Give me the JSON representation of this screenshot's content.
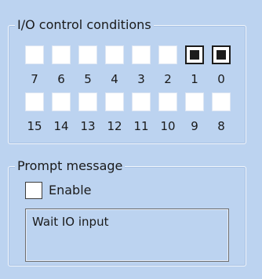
{
  "io_group": {
    "title": "I/O control conditions",
    "row1": [
      {
        "label": "7",
        "checked": false
      },
      {
        "label": "6",
        "checked": false
      },
      {
        "label": "5",
        "checked": false
      },
      {
        "label": "4",
        "checked": false
      },
      {
        "label": "3",
        "checked": false
      },
      {
        "label": "2",
        "checked": false
      },
      {
        "label": "1",
        "checked": true
      },
      {
        "label": "0",
        "checked": true
      }
    ],
    "row2": [
      {
        "label": "15",
        "checked": false
      },
      {
        "label": "14",
        "checked": false
      },
      {
        "label": "13",
        "checked": false
      },
      {
        "label": "12",
        "checked": false
      },
      {
        "label": "11",
        "checked": false
      },
      {
        "label": "10",
        "checked": false
      },
      {
        "label": "9",
        "checked": false
      },
      {
        "label": "8",
        "checked": false
      }
    ]
  },
  "prompt_group": {
    "title": "Prompt message",
    "enable_label": "Enable",
    "enable_checked": false,
    "message": "Wait IO input"
  }
}
